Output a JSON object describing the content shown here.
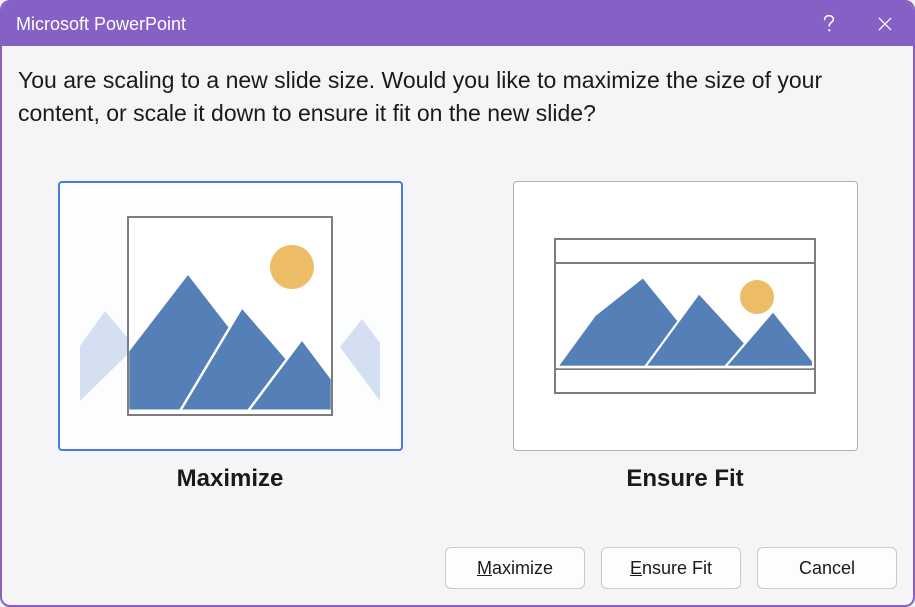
{
  "titlebar": {
    "title": "Microsoft PowerPoint"
  },
  "prompt": "You are scaling to a new slide size.  Would you like to maximize the size of your content, or scale it down to ensure it fit on the new slide?",
  "options": {
    "maximize": {
      "caption": "Maximize",
      "selected": true
    },
    "ensure_fit": {
      "caption": "Ensure Fit",
      "selected": false
    }
  },
  "buttons": {
    "maximize_pre": "",
    "maximize_hot": "M",
    "maximize_post": "aximize",
    "ensure_pre": "",
    "ensure_hot": "E",
    "ensure_post": "nsure Fit",
    "cancel": "Cancel"
  }
}
